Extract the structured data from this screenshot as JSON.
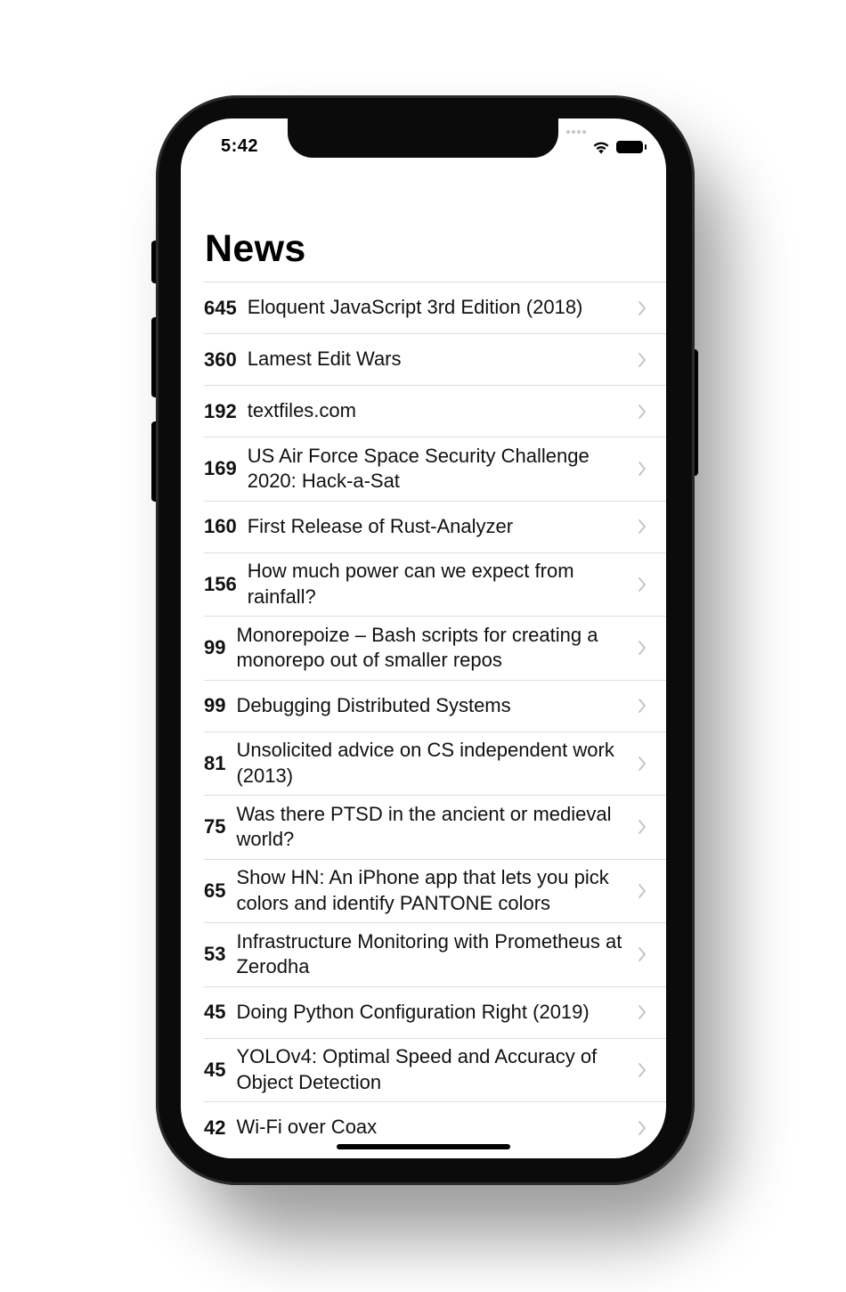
{
  "status_bar": {
    "time": "5:42",
    "signal_icon": "cellular-dots-icon",
    "wifi_icon": "wifi-icon",
    "battery_icon": "battery-full-icon"
  },
  "page": {
    "title": "News"
  },
  "stories": [
    {
      "score": "645",
      "title": "Eloquent JavaScript 3rd Edition (2018)",
      "lines": 1
    },
    {
      "score": "360",
      "title": "Lamest Edit Wars",
      "lines": 1
    },
    {
      "score": "192",
      "title": "textfiles.com",
      "lines": 1
    },
    {
      "score": "169",
      "title": "US Air Force Space Security Challenge 2020: Hack-a-Sat",
      "lines": 2
    },
    {
      "score": "160",
      "title": "First Release of Rust-Analyzer",
      "lines": 1
    },
    {
      "score": "156",
      "title": "How much power can we expect from rainfall?",
      "lines": 2
    },
    {
      "score": "99",
      "title": "Monorepoize – Bash scripts for creating a monorepo out of smaller repos",
      "lines": 2
    },
    {
      "score": "99",
      "title": "Debugging Distributed Systems",
      "lines": 1
    },
    {
      "score": "81",
      "title": "Unsolicited advice on CS independent work (2013)",
      "lines": 2
    },
    {
      "score": "75",
      "title": "Was there PTSD in the ancient or medieval world?",
      "lines": 2
    },
    {
      "score": "65",
      "title": "Show HN: An iPhone app that lets you pick colors and identify PANTONE colors",
      "lines": 2
    },
    {
      "score": "53",
      "title": "Infrastructure Monitoring with Prometheus at Zerodha",
      "lines": 2
    },
    {
      "score": "45",
      "title": "Doing Python Configuration Right (2019)",
      "lines": 1
    },
    {
      "score": "45",
      "title": "YOLOv4: Optimal Speed and Accuracy of Object Detection",
      "lines": 2
    },
    {
      "score": "42",
      "title": "Wi-Fi over Coax",
      "lines": 1
    }
  ],
  "row_icon": "chevron-right-icon",
  "colors": {
    "separator": "#dedede",
    "chevron": "#c4c4c9",
    "text": "#111111",
    "frame": "#0b0b0b"
  }
}
